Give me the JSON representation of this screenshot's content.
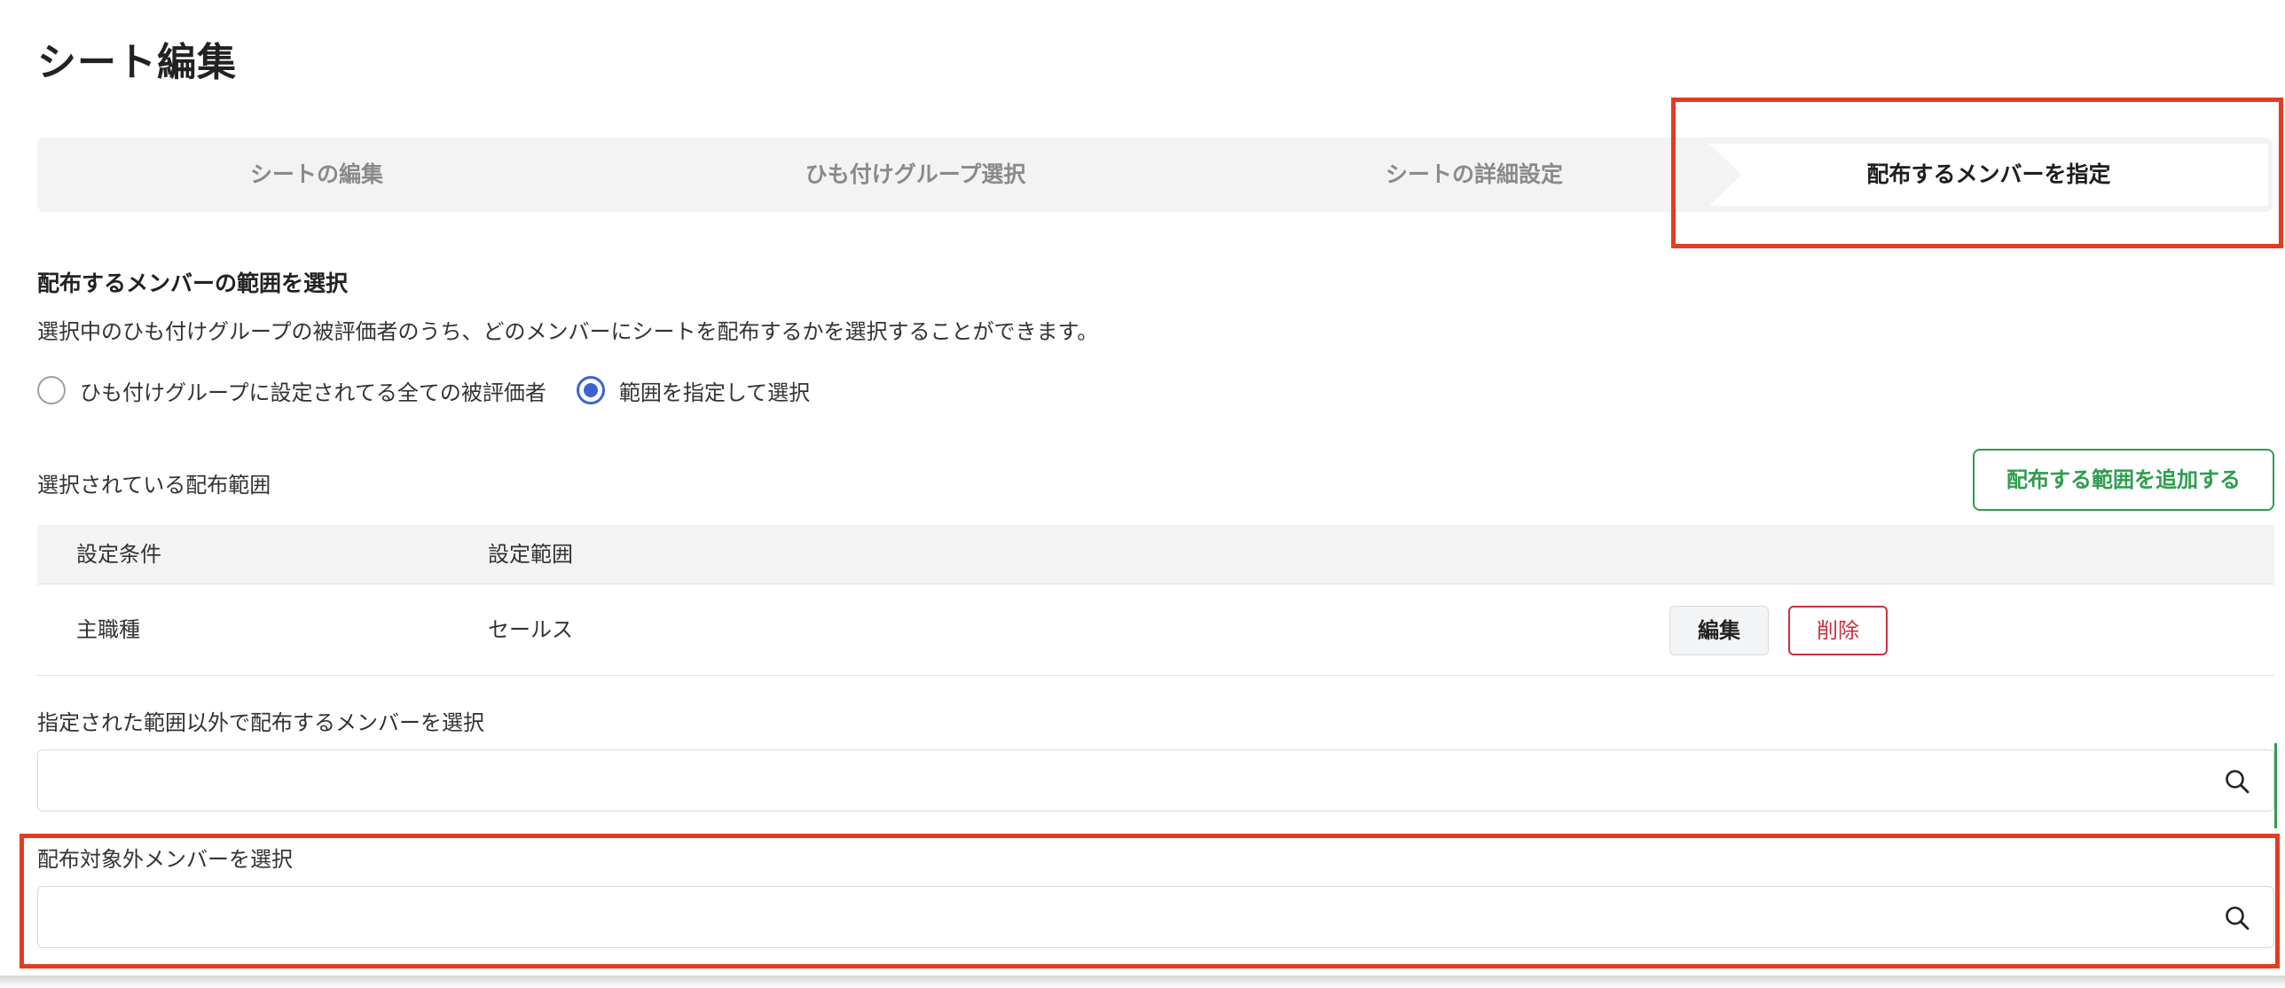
{
  "page": {
    "title": "シート編集"
  },
  "stepper": {
    "steps": [
      {
        "label": "シートの編集",
        "active": false
      },
      {
        "label": "ひも付けグループ選択",
        "active": false
      },
      {
        "label": "シートの詳細設定",
        "active": false
      },
      {
        "label": "配布するメンバーを指定",
        "active": true
      }
    ]
  },
  "scope": {
    "heading": "配布するメンバーの範囲を選択",
    "description": "選択中のひも付けグループの被評価者のうち、どのメンバーにシートを配布するかを選択することができます。",
    "options": [
      {
        "label": "ひも付けグループに設定されてる全ての被評価者",
        "checked": false
      },
      {
        "label": "範囲を指定して選択",
        "checked": true
      }
    ]
  },
  "range_list": {
    "label": "選択されている配布範囲",
    "add_button": "配布する範囲を追加する",
    "columns": [
      "設定条件",
      "設定範囲"
    ],
    "rows": [
      {
        "condition": "主職種",
        "range": "セールス"
      }
    ],
    "edit_label": "編集",
    "delete_label": "削除"
  },
  "extra_members": {
    "label": "指定された範囲以外で配布するメンバーを選択",
    "value": "",
    "placeholder": ""
  },
  "excluded_members": {
    "label": "配布対象外メンバーを選択",
    "value": "",
    "placeholder": ""
  },
  "colors": {
    "highlight": "#e23d22",
    "accent_green": "#2e9d4e",
    "radio_blue": "#3c63d0",
    "danger_red": "#c9303f"
  },
  "icons": {
    "search": "search-icon"
  }
}
